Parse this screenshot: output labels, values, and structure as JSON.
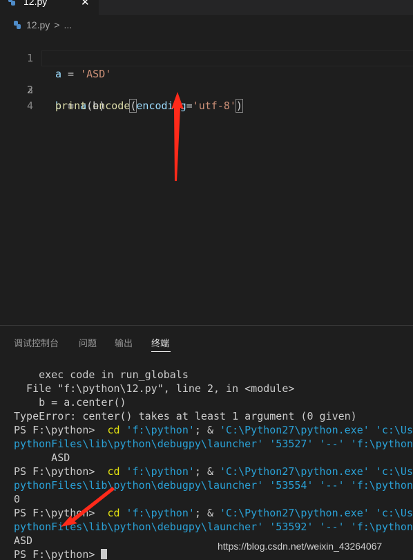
{
  "tab": {
    "label": "12.py",
    "close_glyph": "✕"
  },
  "breadcrumb": {
    "file": "12.py",
    "separator": ">",
    "rest": "..."
  },
  "editor": {
    "lines": [
      {
        "num": "1",
        "var": "a",
        "op": " = ",
        "str": "'ASD'"
      },
      {
        "num": "2",
        "var": "b",
        "op": " = ",
        "obj": "a",
        "method": ".encode",
        "open": "(",
        "param": "encoding",
        "eq": "=",
        "arg": "'utf-8'",
        "close": ")"
      },
      {
        "num": "3",
        "fn": "print",
        "rest": "(b)"
      },
      {
        "num": "4"
      }
    ]
  },
  "panel": {
    "tabs": [
      "调试控制台",
      "问题",
      "输出",
      "终端"
    ],
    "active_tab": "终端"
  },
  "terminal": {
    "l1": "    exec code in run_globals",
    "l2": "  File \"f:\\python\\12.py\", line 2, in <module>",
    "l3": "    b = a.center()",
    "l4": "TypeError: center() takes at least 1 argument (0 given)",
    "prompt": "PS F:\\python> ",
    "cd": " cd",
    "cd_arg": " 'f:\\python'",
    "amp": "; & ",
    "exe": "'C:\\Python27\\python.exe'",
    "exe_tail": " 'c:\\Us",
    "launcher1": "pythonFiles\\lib\\python\\debugpy\\launcher' '53527' '--' 'f:\\python",
    "out1": "      ASD",
    "launcher2": "pythonFiles\\lib\\python\\debugpy\\launcher' '53554' '--' 'f:\\python",
    "out2": "0",
    "launcher3": "pythonFiles\\lib\\python\\debugpy\\launcher' '53592' '--' 'f:\\python",
    "out3": "ASD",
    "final_prompt": "PS F:\\python> "
  },
  "watermark": "https://blog.csdn.net/weixin_43264067",
  "colors": {
    "annotation_arrow": "#ff2a1a"
  }
}
